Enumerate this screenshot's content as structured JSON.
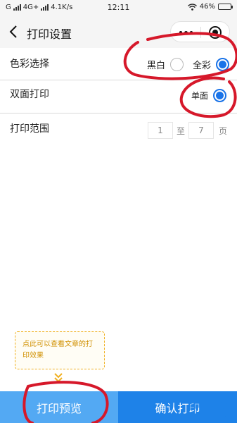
{
  "status_bar": {
    "carrier": "G",
    "network": "4G+",
    "speed": "4.1K/s",
    "time": "12:11",
    "battery": "46%",
    "battery_level": 0.46
  },
  "nav": {
    "title": "打印设置"
  },
  "color_row": {
    "label": "色彩选择",
    "options": [
      {
        "label": "黑白",
        "selected": false
      },
      {
        "label": "全彩",
        "selected": true
      }
    ]
  },
  "duplex_row": {
    "label": "双面打印",
    "options": [
      {
        "label": "单面",
        "selected": true
      }
    ]
  },
  "range_row": {
    "label": "打印范围",
    "from": "1",
    "to_label": "至",
    "to": "7",
    "unit": "页"
  },
  "tooltip": {
    "text": "点此可以查看文章的打印效果"
  },
  "buttons": {
    "preview": "打印预览",
    "confirm": "确认打印"
  },
  "colors": {
    "accent": "#1a73e8",
    "preview_button": "#53a9f3",
    "confirm_button": "#1e82e8",
    "tooltip": "#f0b020",
    "annotation": "#d6182a"
  }
}
